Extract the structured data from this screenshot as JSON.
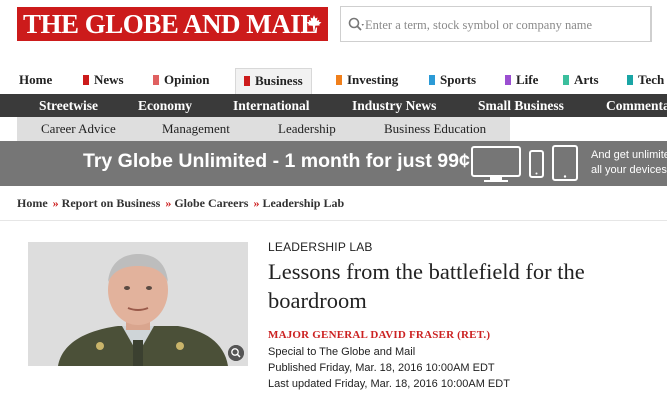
{
  "brand": {
    "name": "THE GLOBE AND MAIL",
    "color": "#cc1b1b"
  },
  "search": {
    "placeholder": "Enter a term, stock symbol or company name"
  },
  "sections": [
    {
      "label": "Home",
      "color": ""
    },
    {
      "label": "News",
      "color": "#cc1b1b"
    },
    {
      "label": "Opinion",
      "color": "#e06060"
    },
    {
      "label": "Business",
      "color": "#cc1b1b"
    },
    {
      "label": "Investing",
      "color": "#f07f1b"
    },
    {
      "label": "Sports",
      "color": "#2b9ad6"
    },
    {
      "label": "Life",
      "color": "#9b4fd1"
    },
    {
      "label": "Arts",
      "color": "#3bbf9d"
    },
    {
      "label": "Tech",
      "color": "#1aa5a5"
    }
  ],
  "subnav": [
    "Streetwise",
    "Economy",
    "International",
    "Industry News",
    "Small Business",
    "Commentary"
  ],
  "tertiary": [
    "Career Advice",
    "Management",
    "Leadership",
    "Business Education"
  ],
  "promo": {
    "headline": "Try Globe Unlimited - 1 month for just 99¢",
    "extra_line1": "And get unlimited",
    "extra_line2": "all your devices"
  },
  "breadcrumb": [
    "Home",
    "Report on Business",
    "Globe Careers",
    "Leadership Lab"
  ],
  "article": {
    "kicker": "LEADERSHIP LAB",
    "title": "Lessons from the battlefield for the boardroom",
    "byline": "MAJOR GENERAL DAVID FRASER (RET.)",
    "source": "Special to The Globe and Mail",
    "published": "Published Friday, Mar. 18, 2016 10:00AM EDT",
    "updated": "Last updated Friday, Mar. 18, 2016 10:00AM EDT"
  },
  "icons": {
    "search": "search-icon",
    "zoom": "zoom-icon",
    "leaf": "maple-leaf-icon"
  }
}
